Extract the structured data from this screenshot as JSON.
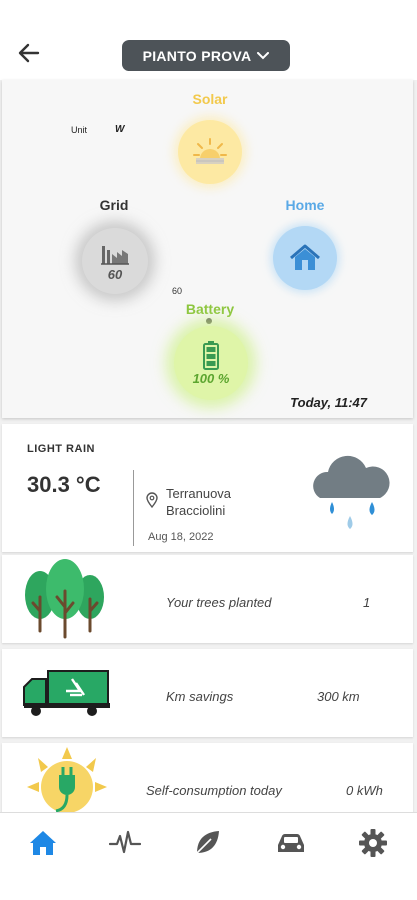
{
  "header": {
    "plant_name": "PIANTO PROVA"
  },
  "energy_flow": {
    "unit_label": "Unit",
    "unit_value": "W",
    "solar": {
      "label": "Solar",
      "color": "#f2c94c"
    },
    "grid": {
      "label": "Grid",
      "value": "60",
      "color": "#333333"
    },
    "home": {
      "label": "Home",
      "color": "#5aa9e6"
    },
    "battery": {
      "label": "Battery",
      "value": "100 %",
      "color": "#8dc63f",
      "level": 1.0
    },
    "flow_value": "60",
    "timestamp": "Today, 11:47"
  },
  "weather": {
    "condition": "LIGHT RAIN",
    "temperature": "30.3 °C",
    "location": "Terranuova Bracciolini",
    "date": "Aug 18, 2022",
    "icon": "cloud-rain-icon"
  },
  "stats": [
    {
      "icon": "trees-icon",
      "label": "Your trees planted",
      "value": "1"
    },
    {
      "icon": "recycling-truck-icon",
      "label": "Km savings",
      "value": "300 km"
    },
    {
      "icon": "solar-plug-icon",
      "label": "Self-consumption today",
      "value": "0 kWh"
    }
  ],
  "tabs": [
    {
      "icon": "home-icon",
      "active": true
    },
    {
      "icon": "pulse-icon",
      "active": false
    },
    {
      "icon": "leaf-icon",
      "active": false
    },
    {
      "icon": "car-icon",
      "active": false
    },
    {
      "icon": "gear-icon",
      "active": false
    }
  ],
  "colors": {
    "accent": "#1e88e5",
    "icon_dark": "#555555",
    "green": "#2e9e5b"
  }
}
